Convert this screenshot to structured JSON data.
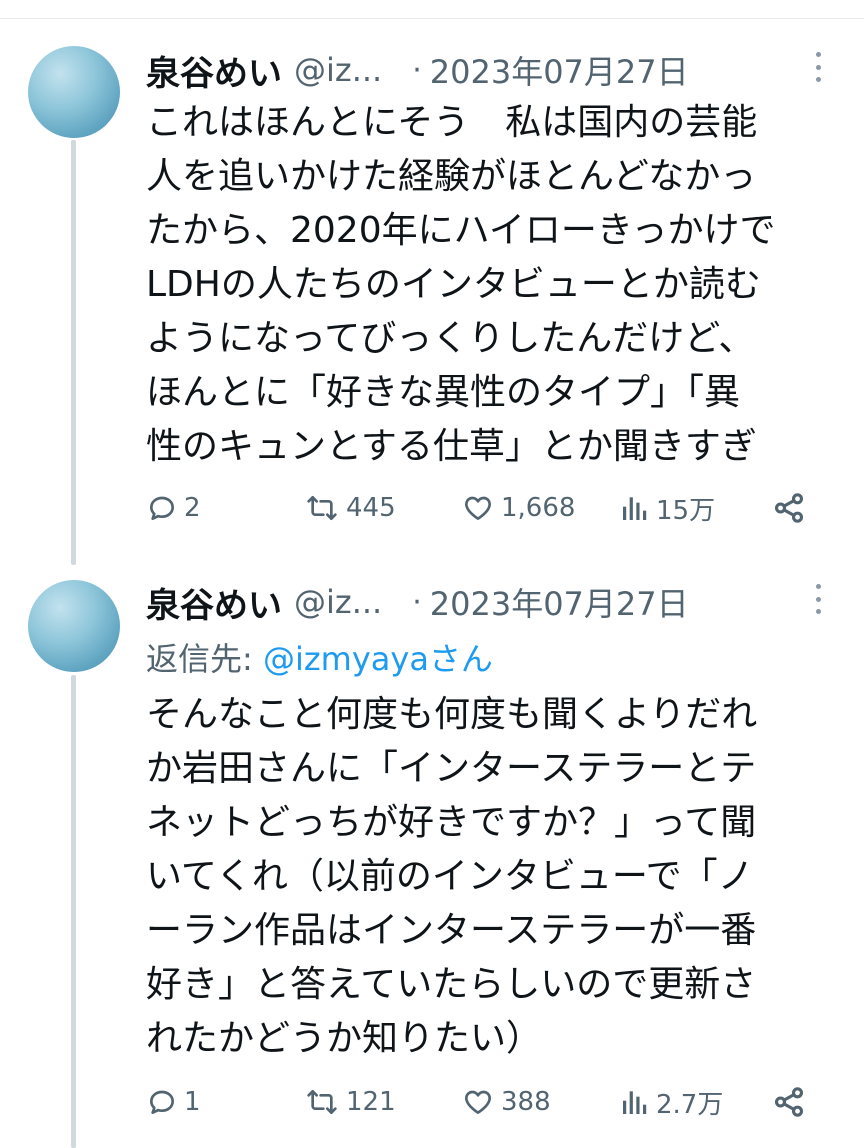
{
  "tweets": [
    {
      "author_name": "泉谷めい",
      "handle": "@iz...",
      "separator": "·",
      "date": "2023年07月27日",
      "reply_label": "",
      "reply_mention": "",
      "reply_suffix": "",
      "text_lines": [
        "これはほんとにそう　私は国内の芸能",
        "人を追いかけた経験がほとんどなかっ",
        "たから、2020年にハイローきっかけで",
        "LDHの人たちのインタビューとか読む",
        "ようになってびっくりしたんだけど、",
        "ほんとに「好きな異性のタイプ」「異",
        "性のキュンとする仕草」とか聞きすぎ"
      ],
      "actions": {
        "replies": "2",
        "retweets": "445",
        "likes": "1,668",
        "views": "15万"
      },
      "icons": [
        "reply-icon",
        "retweet-icon",
        "like-icon",
        "views-icon",
        "share-icon",
        "more-icon"
      ]
    },
    {
      "author_name": "泉谷めい",
      "handle": "@iz...",
      "separator": "·",
      "date": "2023年07月27日",
      "reply_label": "返信先: ",
      "reply_mention": "@izmyaya",
      "reply_suffix": "さん",
      "text_lines": [
        "そんなこと何度も何度も聞くよりだれ",
        "か岩田さんに「インターステラーとテ",
        "ネットどっちが好きですか？」って聞",
        "いてくれ（以前のインタビューで「ノ",
        "ーラン作品はインターステラーが一番",
        "好き」と答えていたらしいので更新さ",
        "れたかどうか知りたい）"
      ],
      "actions": {
        "replies": "1",
        "retweets": "121",
        "likes": "388",
        "views": "2.7万"
      },
      "icons": [
        "reply-icon",
        "retweet-icon",
        "like-icon",
        "views-icon",
        "share-icon",
        "more-icon"
      ]
    }
  ],
  "colors": {
    "text": "#0f1419",
    "secondary": "#536471",
    "link": "#1d9bf0",
    "thread_line": "#cfd9de"
  }
}
